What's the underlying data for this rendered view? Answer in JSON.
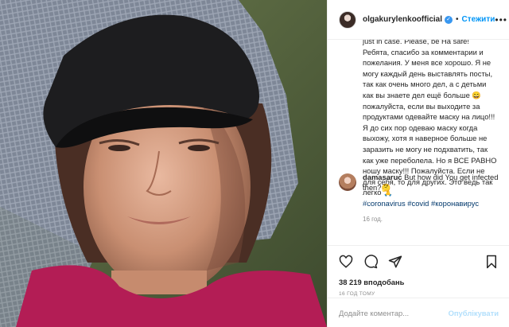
{
  "header": {
    "username": "olgakurylenkoofficial",
    "verified_icon": "verified-badge-icon",
    "separator": "•",
    "follow_label": "Стежити",
    "more_icon": "more-options-icon"
  },
  "caption": {
    "partial_top_line": "just in case. Please, be Ha safe!",
    "text": "Ребята, спасибо за комментарии и пожелания. У меня все хорошо. Я не могу каждый день выставлять посты, так как очень много дел, а с детьми как вы знаете дел ещё больше 😄 пожалуйста, если вы выходите за продуктами одевайте маску на лицо!!! Я до сих пор одеваю маску когда выхожу, хотя я наверное больше не заразить не могу не подхватить, так как уже переболела. Но я ВСЕ РАВНО ношу маску!!! Пожалуйста. Если не для себя, то для других. Это ведь так легко 🙏",
    "hashtags": [
      "#coronavirus",
      "#covid",
      "#коронавирус"
    ],
    "ago": "16 год."
  },
  "comment": {
    "username": "damasaruc",
    "text": "But how did You get infected then?🤔",
    "next_partial": "…"
  },
  "actions": {
    "like_icon": "heart-icon",
    "comment_icon": "comment-icon",
    "share_icon": "share-icon",
    "save_icon": "bookmark-icon",
    "likes": "38 219 вподобань",
    "timestamp": "16 ГОД ТОМУ"
  },
  "add_comment": {
    "placeholder": "Додайте коментар...",
    "publish_label": "Опублікувати"
  },
  "colors": {
    "link_blue": "#0095f6",
    "hashtag": "#00376b",
    "muted": "#8e8e8e",
    "publish_disabled": "#b2dffc"
  }
}
